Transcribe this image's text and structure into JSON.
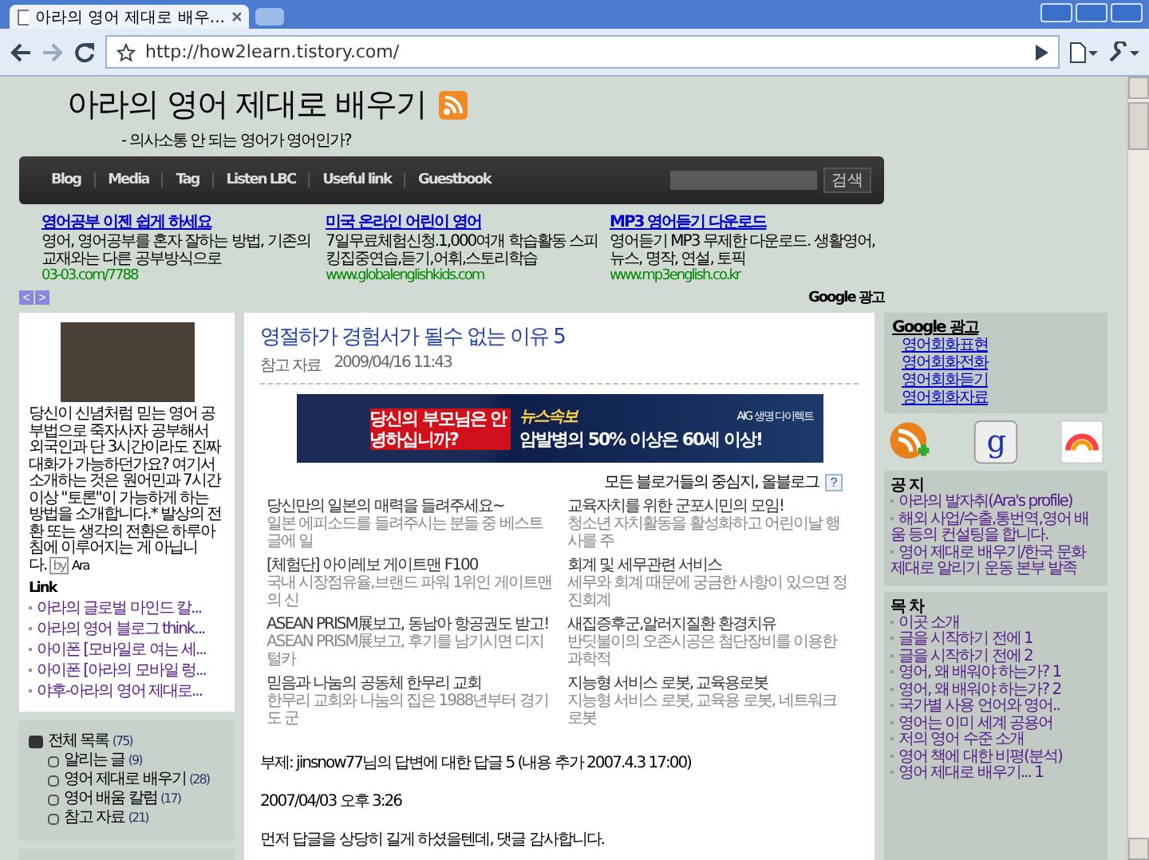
{
  "browser": {
    "tab_title": "아라의 영어 제대로 배우...",
    "url": "http://how2learn.tistory.com/"
  },
  "blog": {
    "title": "아라의 영어 제대로 배우기",
    "subtitle": "- 의사소통 안 되는 영어가 영어인가?"
  },
  "nav": {
    "items": [
      "Blog",
      "Media",
      "Tag",
      "Listen LBC",
      "Useful link",
      "Guestbook"
    ],
    "search_button": "검색"
  },
  "ads": [
    {
      "title": "영어공부 이젠 쉽게 하세요",
      "desc": "영어, 영어공부를 혼자 잘하는 방법, 기존의 교재와는 다른 공부방식으로",
      "url": "03-03.com/7788"
    },
    {
      "title": "미국 온라인 어린이 영어",
      "desc": "7일무료체험신청.1,000여개 학습활동 스피킹집중연습,듣기,어휘,스토리학습",
      "url": "www.globalenglishkids.com"
    },
    {
      "title": "MP3 영어듣기 다운로드",
      "desc": "영어듣기 MP3 무제한 다운로드. 생활영어, 뉴스, 명작, 연설, 토픽",
      "url": "www.mp3english.co.kr"
    }
  ],
  "ad_pager": [
    "<",
    ">"
  ],
  "ads_label": "Google 광고",
  "profile": {
    "bio": "당신이 신념처럼 믿는 영어 공부법으로 죽자사자 공부해서 외국인과 단 3시간이라도 진짜 대화가 가능하던가요? 여기서 소개하는 것은 원어민과 7시간 이상 \"토론\"이 가능하게 하는 방법을 소개합니다.* 발상의 전환 또는 생각의 전환은 하루아침에 이루어지는 게 아닙니다.",
    "by": "by",
    "author": "Ara"
  },
  "links": {
    "title": "Link",
    "items": [
      "아라의 글로벌 마인드 칼...",
      "아라의 영어 블로그 think...",
      "아이폰 [모바일로 여는 세...",
      "아이폰 [아라의 모바일 렁...",
      "야후-아라의 영어 제대로..."
    ]
  },
  "categories": {
    "label": "전체 목록",
    "count": "(75)",
    "children": [
      {
        "label": "알리는 글",
        "count": "(9)"
      },
      {
        "label": "영어 제대로 배우기",
        "count": "(28)"
      },
      {
        "label": "영어 배움 칼럼",
        "count": "(17)"
      },
      {
        "label": "참고 자료",
        "count": "(21)"
      }
    ]
  },
  "post": {
    "title": "영절하가 경험서가 될수 없는 이유 5",
    "category": "참고 자료",
    "date": "2009/04/16 11:43",
    "banner": {
      "headline": "당신의 부모님은 안녕하십니까?",
      "tag": "뉴스속보",
      "sponsor": "AIG 생명 다이렉트",
      "message": "암발병의 50% 이상은 60세 이상!"
    },
    "allblog": {
      "label": "모든 블로거들의 중심지, 올블로그",
      "help": "?"
    },
    "promos": [
      {
        "title": "당신만의 일본의 매력을 들려주세요~",
        "desc": "일본 에피소드를 들려주시는 분들 중 베스트글에 일"
      },
      {
        "title": "교육자치를 위한 군포시민의 모임!",
        "desc": "청소년 자치활동을 활성화하고 어린이날 행사를 주"
      },
      {
        "title": "[체험단] 아이레보 게이트맨 F100",
        "desc": "국내 시장점유율,브랜드 파워 1위인 게이트맨의 신"
      },
      {
        "title": "회계 및 세무관련 서비스",
        "desc": "세무와 회계 때문에 궁금한 사항이 있으면 정진회계"
      },
      {
        "title": "ASEAN PRISM展보고, 동남아 항공권도 받고!",
        "desc": "ASEAN PRISM展보고, 후기를 남기시면 디지털카"
      },
      {
        "title": "새집증후군,알러지질환 환경치유",
        "desc": "반딧불이의 오존시공은 첨단장비를 이용한 과학적"
      },
      {
        "title": "믿음과 나눔의 공동체 한무리 교회",
        "desc": "한무리 교회와 나눔의 집은 1988년부터 경기도 군"
      },
      {
        "title": "지능형 서비스 로봇, 교육용로봇",
        "desc": "지능형 서비스 로봇, 교육용 로봇, 네트워크 로봇"
      }
    ],
    "paragraphs": [
      "부제: jinsnow77님의 답변에 대한 답글 5 (내용 추가 2007.4.3 17:00)",
      "2007/04/03 오후 3:26",
      "먼저 답글을 상당히 길게 하셨을텐데, 댓글 감사합니다."
    ]
  },
  "sidebar_right": {
    "ads_title": "Google 광고",
    "google_letter": "g",
    "ads": [
      "영어회화표현",
      "영어회화전화",
      "영어회화듣기",
      "영어회화자료"
    ],
    "notice": {
      "title": "공 지",
      "items": [
        "아라의 발자취(Ara's profile)",
        "해외 사업/수출,통번역,영어 배움 등의 컨설팅을 합니다.",
        "영어 제대로 배우기/한국 문화 제대로 알리기 운동 본부 발족"
      ]
    },
    "toc": {
      "title": "목 차",
      "items": [
        "이곳 소개",
        "글을 시작하기 전에 1",
        "글을 시작하기 전에 2",
        "영어, 왜 배워야 하는가? 1",
        "영어, 왜 배워야 하는가? 2",
        "국가별 사용 언어와 영어..",
        "영어는 이미 세계 공용어",
        "저의 영어 수준 소개",
        "영어 책에 대한 비평(분석)",
        "영어 제대로 배우기... 1"
      ]
    }
  }
}
